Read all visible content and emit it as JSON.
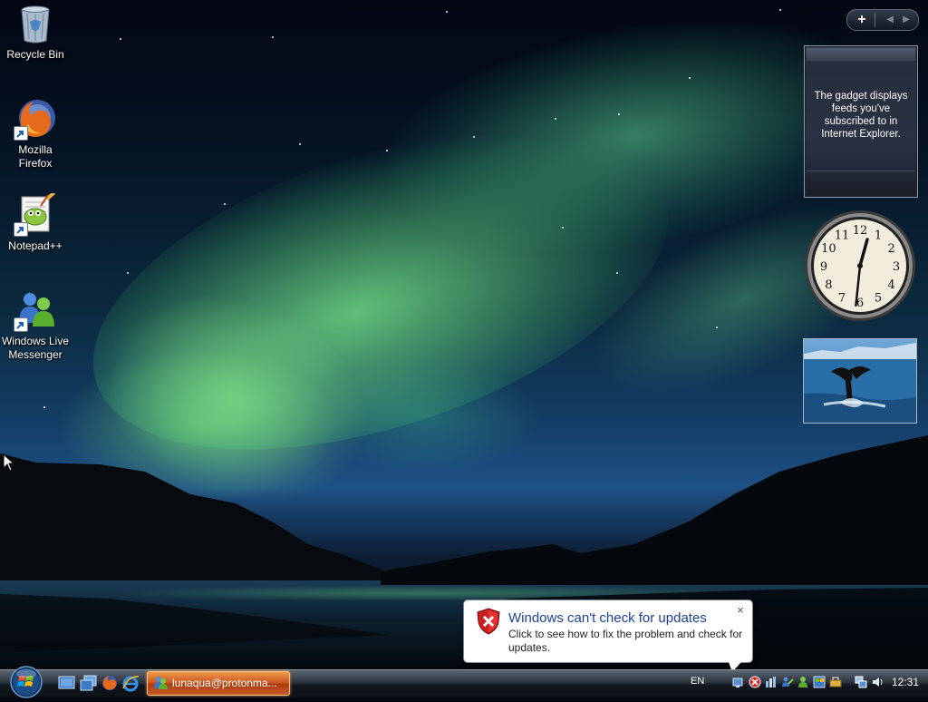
{
  "desktop": {
    "icons": [
      {
        "label": "Recycle Bin",
        "icon": "recycle-bin-icon"
      },
      {
        "label": "Mozilla Firefox",
        "icon": "firefox-icon"
      },
      {
        "label": "Notepad++",
        "icon": "notepad-plus-plus-icon"
      },
      {
        "label": "Windows Live Messenger",
        "icon": "messenger-icon"
      }
    ]
  },
  "sidebar": {
    "add_gadget": "+",
    "prev": "◀",
    "next": "▶",
    "feed_gadget": {
      "message": "The gadget displays feeds you've subscribed to in Internet Explorer."
    },
    "clock": {
      "numerals": [
        "12",
        "1",
        "2",
        "3",
        "4",
        "5",
        "6",
        "7",
        "8",
        "9",
        "10",
        "11"
      ],
      "hour": 12,
      "minute": 31
    },
    "slideshow": {
      "subject": "whale-tail-photo"
    }
  },
  "notification": {
    "title": "Windows can't check for updates",
    "body": "Click to see how to fix the problem and check for updates.",
    "close": "×",
    "icon": "security-shield-icon"
  },
  "taskbar": {
    "start": "start-orb",
    "quick_launch": [
      "show-desktop-icon",
      "switch-windows-icon",
      "firefox-icon",
      "internet-explorer-icon"
    ],
    "task": {
      "label": "lunaqua@protonma...",
      "icon": "messenger-icon"
    },
    "language": "EN",
    "tray_icons": [
      "network-icon",
      "security-alert-icon",
      "volume-devices-icon",
      "messenger-tray-icon",
      "messenger-status-icon",
      "windows-update-icon",
      "tools-icon",
      "network-monitor-icon",
      "speaker-icon"
    ],
    "time": "12:31"
  },
  "colors": {
    "taskbar_dark": "#12171f",
    "task_button": "#c8551f",
    "notification_title": "#1e3f96",
    "aurora_green": "#7df08c"
  }
}
